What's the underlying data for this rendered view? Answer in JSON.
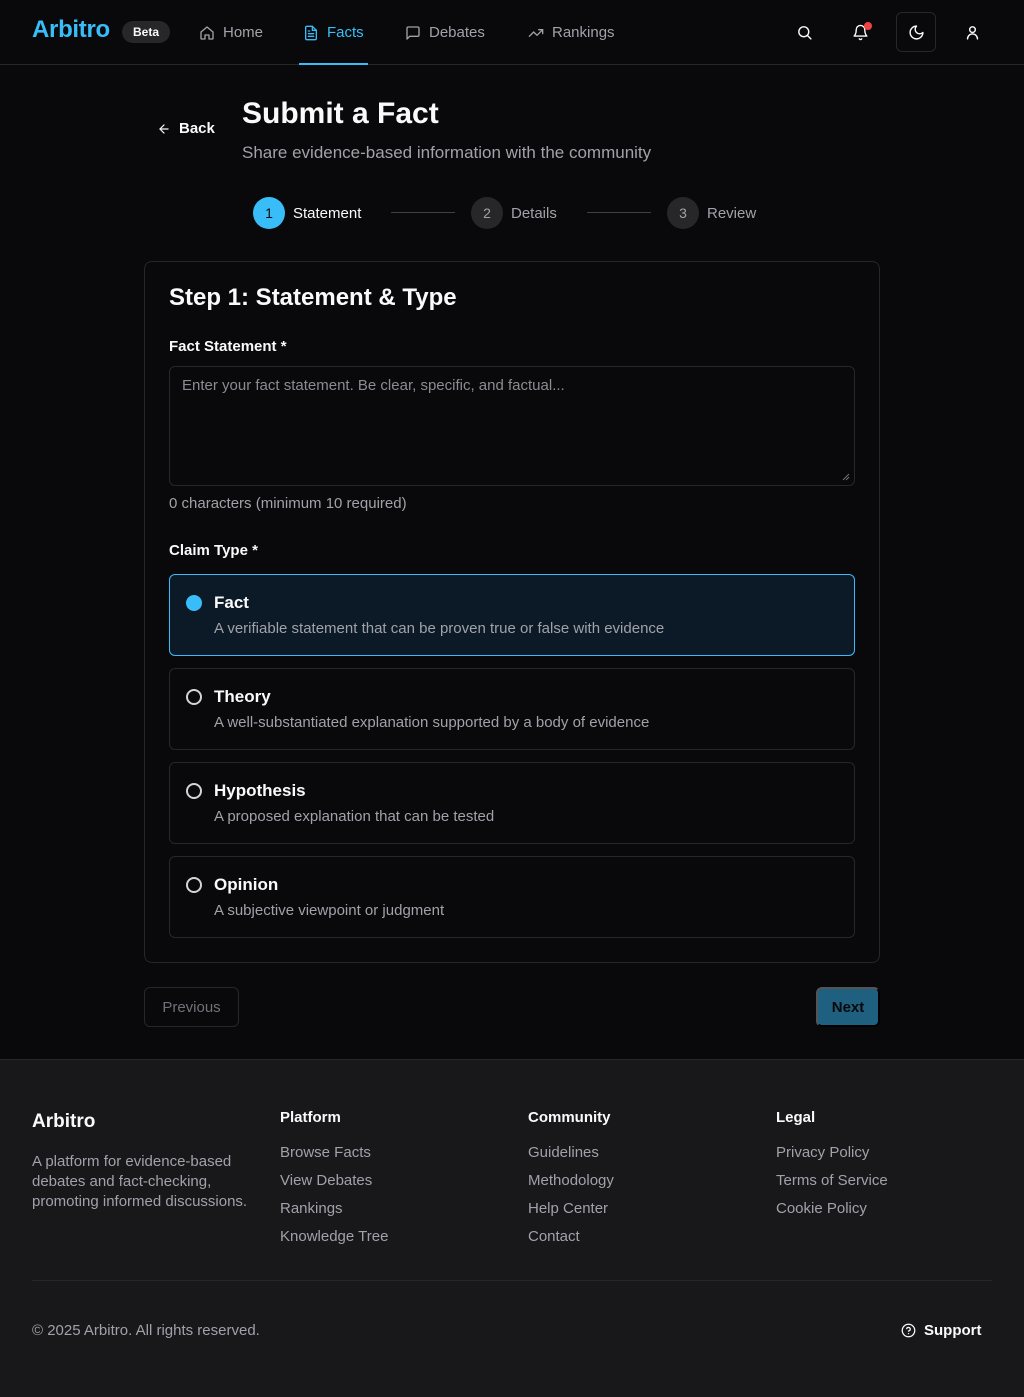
{
  "header": {
    "logo": "Arbitro",
    "badge": "Beta",
    "nav": [
      {
        "label": "Home",
        "icon": "home-icon",
        "active": false
      },
      {
        "label": "Facts",
        "icon": "document-icon",
        "active": true
      },
      {
        "label": "Debates",
        "icon": "message-icon",
        "active": false
      },
      {
        "label": "Rankings",
        "icon": "trending-up-icon",
        "active": false
      }
    ],
    "actions": [
      "search-icon",
      "bell-icon",
      "moon-icon",
      "user-icon"
    ]
  },
  "page": {
    "back_label": "Back",
    "title": "Submit a Fact",
    "subtitle": "Share evidence-based information with the community"
  },
  "stepper": [
    {
      "num": "1",
      "label": "Statement",
      "active": true
    },
    {
      "num": "2",
      "label": "Details",
      "active": false
    },
    {
      "num": "3",
      "label": "Review",
      "active": false
    }
  ],
  "form": {
    "card_title": "Step 1: Statement & Type",
    "statement_label": "Fact Statement *",
    "statement_value": "",
    "statement_placeholder": "Enter your fact statement. Be clear, specific, and factual...",
    "char_count": "0 characters (minimum 10 required)",
    "claim_type_label": "Claim Type *",
    "options": [
      {
        "title": "Fact",
        "desc": "A verifiable statement that can be proven true or false with evidence",
        "selected": true
      },
      {
        "title": "Theory",
        "desc": "A well-substantiated explanation supported by a body of evidence",
        "selected": false
      },
      {
        "title": "Hypothesis",
        "desc": "A proposed explanation that can be tested",
        "selected": false
      },
      {
        "title": "Opinion",
        "desc": "A subjective viewpoint or judgment",
        "selected": false
      }
    ],
    "prev_label": "Previous",
    "next_label": "Next"
  },
  "footer": {
    "brand": "Arbitro",
    "description": "A platform for evidence-based debates and fact-checking, promoting informed discussions.",
    "columns": [
      {
        "title": "Platform",
        "links": [
          "Browse Facts",
          "View Debates",
          "Rankings",
          "Knowledge Tree"
        ]
      },
      {
        "title": "Community",
        "links": [
          "Guidelines",
          "Methodology",
          "Help Center",
          "Contact"
        ]
      },
      {
        "title": "Legal",
        "links": [
          "Privacy Policy",
          "Terms of Service",
          "Cookie Policy"
        ]
      }
    ],
    "copyright": "© 2025 Arbitro. All rights reserved.",
    "support_label": "Support"
  },
  "colors": {
    "accent": "#38bdf8",
    "background": "#09090b",
    "footer_bg": "#18181b",
    "border": "#27272a",
    "notification": "#ef4444"
  }
}
